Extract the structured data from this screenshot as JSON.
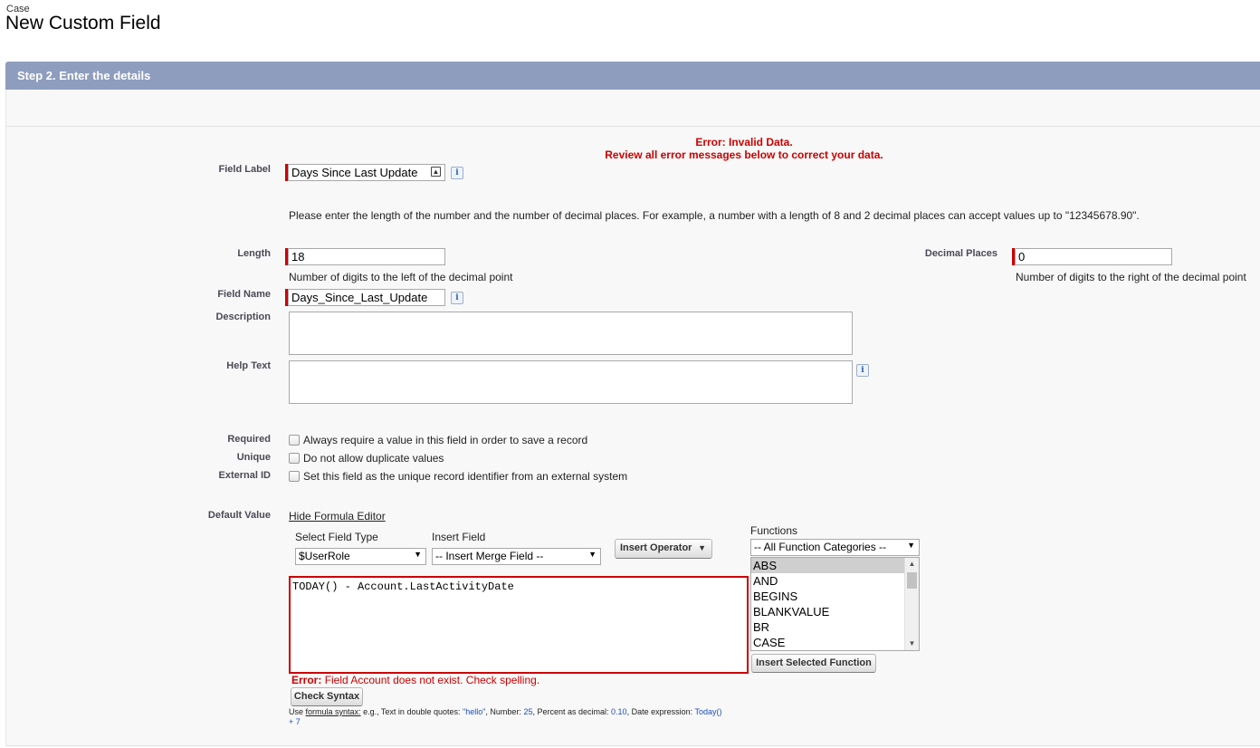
{
  "header": {
    "object_type": "Case",
    "title": "New Custom Field"
  },
  "section": {
    "title": "Step 2. Enter the details"
  },
  "error": {
    "line1": "Error: Invalid Data.",
    "line2": "Review all error messages below to correct your data."
  },
  "field_label": {
    "label": "Field Label",
    "value": "Days Since Last Update"
  },
  "instructions": "Please enter the length of the number and the number of decimal places. For example, a number with a length of 8 and 2 decimal places can accept values up to \"12345678.90\".",
  "length": {
    "label": "Length",
    "value": "18",
    "hint": "Number of digits to the left of the decimal point"
  },
  "decimal_places": {
    "label": "Decimal Places",
    "value": "0",
    "hint": "Number of digits to the right of the decimal point"
  },
  "field_name": {
    "label": "Field Name",
    "value": "Days_Since_Last_Update"
  },
  "description": {
    "label": "Description",
    "value": ""
  },
  "help_text": {
    "label": "Help Text",
    "value": ""
  },
  "required": {
    "label": "Required",
    "text": "Always require a value in this field in order to save a record"
  },
  "unique": {
    "label": "Unique",
    "text": "Do not allow duplicate values"
  },
  "external_id": {
    "label": "External ID",
    "text": "Set this field as the unique record identifier from an external system"
  },
  "default_value": {
    "label": "Default Value",
    "hide_editor_link": "Hide Formula Editor",
    "select_field_type_label": "Select Field Type",
    "select_field_type_value": "$UserRole",
    "insert_field_label": "Insert Field",
    "insert_field_value": "-- Insert Merge Field --",
    "insert_operator_label": "Insert Operator",
    "functions_label": "Functions",
    "function_category": "-- All Function Categories --",
    "functions": [
      "ABS",
      "AND",
      "BEGINS",
      "BLANKVALUE",
      "BR",
      "CASE"
    ],
    "insert_selected_function": "Insert Selected Function",
    "formula": "TODAY() - Account.LastActivityDate",
    "error_prefix": "Error:",
    "error_text": "Field Account does not exist. Check spelling.",
    "check_syntax": "Check Syntax",
    "syntax_hint": {
      "use": "Use",
      "link": "formula syntax:",
      "t1": "e.g., Text in double quotes:",
      "v1": "\"hello\"",
      "t2": ", Number:",
      "v2": "25",
      "t3": ", Percent as decimal:",
      "v3": "0.10",
      "t4": ", Date expression:",
      "v4": "Today()",
      "v5": "+ 7"
    }
  },
  "colors": {
    "header_bar": "#8e9dbe",
    "error": "#cc0000",
    "link_blue": "#1d4fbf"
  }
}
